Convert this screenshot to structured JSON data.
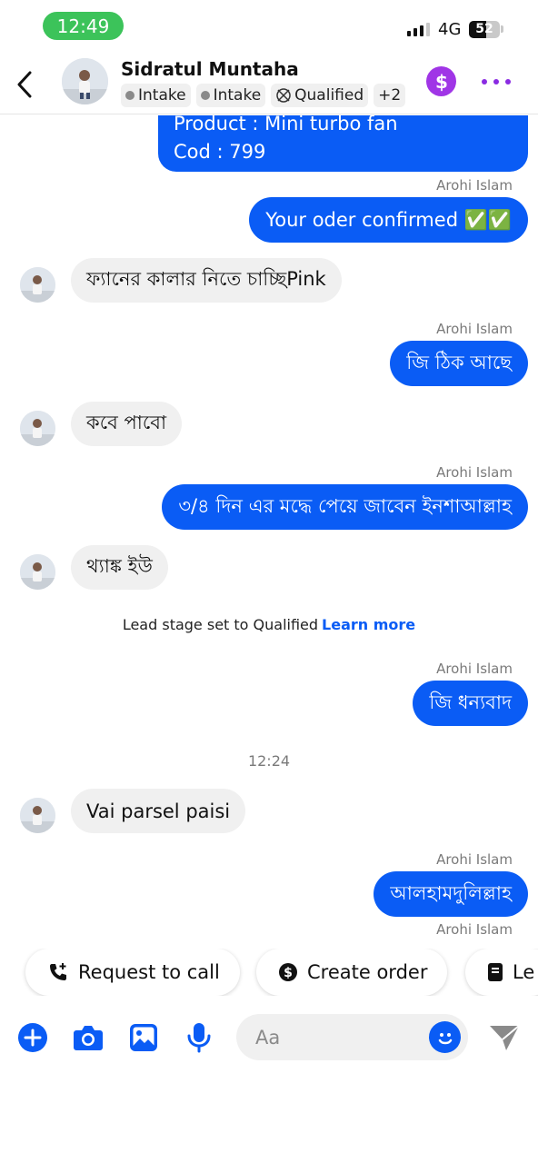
{
  "status_bar": {
    "time": "12:49",
    "network": "4G",
    "battery": "52"
  },
  "header": {
    "contact_name": "Sidratul Muntaha",
    "tags": [
      "Intake",
      "Intake",
      "Qualified"
    ],
    "more_tags": "+2"
  },
  "thread": {
    "top_message": {
      "line1": "Product : Mini turbo fan",
      "line2": "Cod : 799"
    },
    "messages": [
      {
        "sender": "Arohi Islam",
        "text": "Your oder confirmed ✅✅"
      },
      {
        "text": "ফ্যানের কালার নিতে চাচ্ছিPink"
      },
      {
        "sender": "Arohi Islam",
        "text": "জি ঠিক আছে"
      },
      {
        "text": "কবে পাবো"
      },
      {
        "sender": "Arohi Islam",
        "text": "৩/৪ দিন এর মদ্ধে পেয়ে জাবেন ইনশাআল্লাহ"
      },
      {
        "text": "থ্যাঙ্ক ইউ"
      },
      {
        "sender": "Arohi Islam",
        "text": "জি ধন্যবাদ"
      },
      {
        "text": "Vai parsel paisi"
      },
      {
        "sender": "Arohi Islam",
        "text": "আলহামদুলিল্লাহ"
      },
      {
        "sender": "Arohi Islam"
      }
    ],
    "system_note": {
      "text": "Lead stage set to Qualified",
      "link": "Learn more"
    },
    "timestamp": "12:24"
  },
  "quick_replies": [
    "Request to call",
    "Create order",
    "Le"
  ],
  "composer": {
    "placeholder": "Aa"
  },
  "colors": {
    "accent": "#0a5cf5",
    "status_pill": "#3cc35a",
    "payment": "#a035e6",
    "more": "#8a2be2"
  }
}
